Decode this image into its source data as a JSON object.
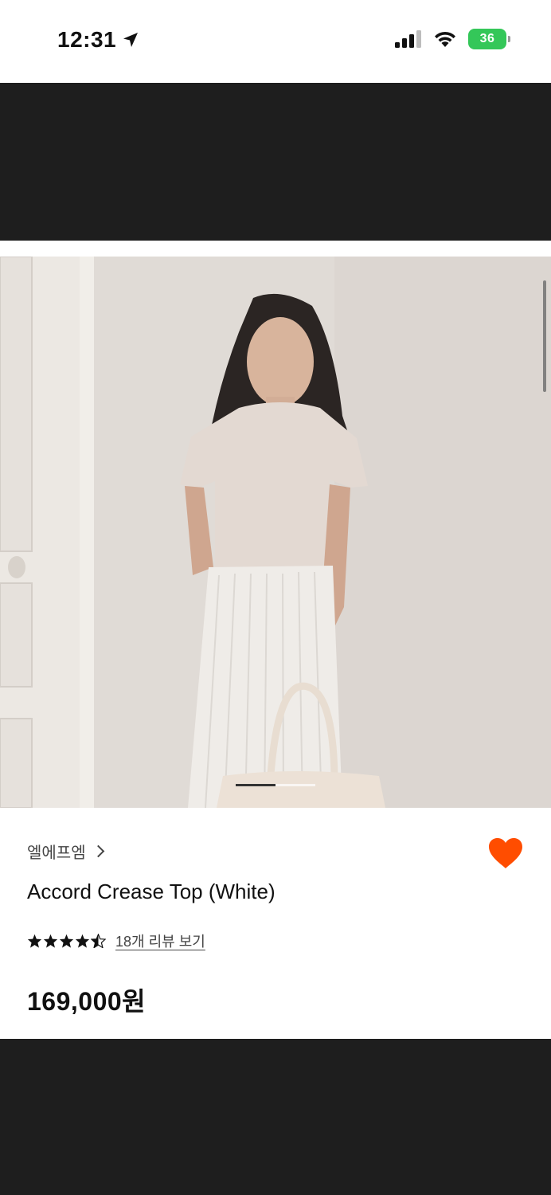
{
  "status_bar": {
    "time": "12:31",
    "location_icon": "location-arrow-icon",
    "signal_icon": "cellular-signal-icon",
    "wifi_icon": "wifi-icon",
    "battery_level": "36",
    "battery_color": "#34c759"
  },
  "product": {
    "brand": "엘에프엠",
    "title": "Accord Crease Top (White)",
    "rating": 4.5,
    "rating_max": 5,
    "reviews_link": "18개 리뷰 보기",
    "price": "169,000원",
    "wishlist_icon": "heart-icon",
    "wishlist_color": "#ff4d00",
    "image_count": 2,
    "image_current": 1
  },
  "colors": {
    "dark_band": "#1e1e1e",
    "background": "#ffffff"
  }
}
